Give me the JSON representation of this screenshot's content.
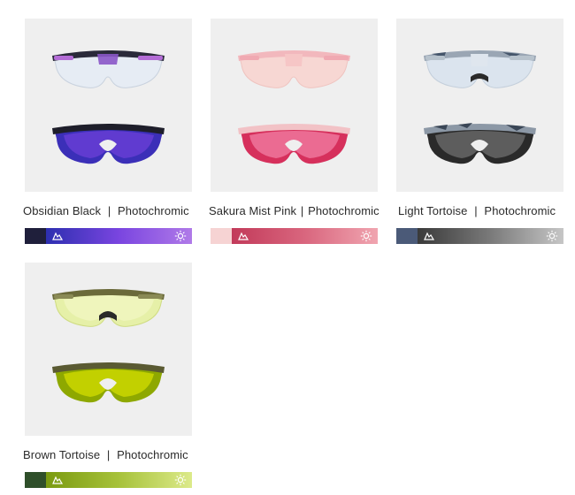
{
  "products": [
    {
      "name": "Obsidian Black",
      "separator": "|",
      "lens_type": "Photochromic",
      "frame_color": "#2a2a3a",
      "temple_color": "#b36cd6",
      "clear_lens_color": "#e6ecf4",
      "dark_lens_colors": [
        "#3b2fb8",
        "#6a3fd6",
        "#2a2a9a"
      ],
      "swatch_color": "#1f1f3b",
      "gradient": [
        "#2d2fb0",
        "#7a45e0",
        "#b07ae8"
      ],
      "icons": [
        "cloud-icon",
        "sun-icon"
      ]
    },
    {
      "name": "Sakura Mist Pink",
      "separator": "|",
      "lens_type": "Photochromic",
      "frame_color": "#f2b8bd",
      "temple_color": "#f0a9b2",
      "clear_lens_color": "#f7d7d3",
      "dark_lens_colors": [
        "#e04a7a",
        "#d6305c",
        "#f07aa0"
      ],
      "swatch_color": "#f6d3d3",
      "gradient": [
        "#c23a5a",
        "#d9667e",
        "#f0a5b0"
      ],
      "icons": [
        "cloud-icon",
        "sun-icon"
      ]
    },
    {
      "name": "Light Tortoise",
      "separator": "|",
      "lens_type": "Photochromic",
      "frame_color": "#9aa6b4",
      "temple_color": "#b7c2cc",
      "clear_lens_color": "#dbe4ee",
      "dark_lens_colors": [
        "#4a4a4a",
        "#2a2a2a",
        "#6a6a6a"
      ],
      "swatch_color": "#4b5a78",
      "gradient": [
        "#3a3a3a",
        "#7a7a7a",
        "#c6c6c6"
      ],
      "icons": [
        "cloud-icon",
        "sun-icon"
      ]
    },
    {
      "name": "Brown Tortoise",
      "separator": "|",
      "lens_type": "Photochromic",
      "frame_color": "#6b6a3a",
      "temple_color": "#8a8a55",
      "clear_lens_color": "#e6f0a8",
      "dark_lens_colors": [
        "#c8d400",
        "#8ea800",
        "#d8e24a"
      ],
      "swatch_color": "#2f4f2a",
      "gradient": [
        "#7a9a10",
        "#a7c23a",
        "#dcea8a"
      ],
      "icons": [
        "cloud-icon",
        "sun-icon"
      ]
    }
  ]
}
